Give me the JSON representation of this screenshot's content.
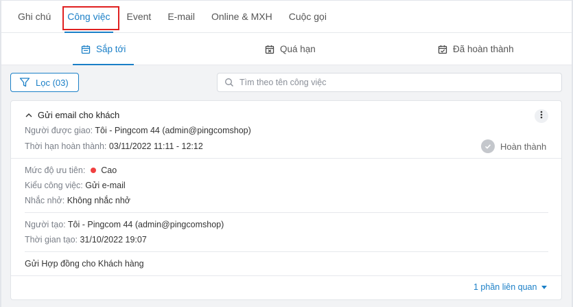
{
  "tabs": [
    "Ghi chú",
    "Công việc",
    "Event",
    "E-mail",
    "Online & MXH",
    "Cuộc gọi"
  ],
  "active_tab_index": 1,
  "subtabs": {
    "upcoming": "Sắp tới",
    "overdue": "Quá hạn",
    "done": "Đã hoàn thành"
  },
  "filter_label": "Lọc (03)",
  "search_placeholder": "Tìm theo tên công việc",
  "task": {
    "title": "Gửi email cho khách",
    "assignee_label": "Người được giao:",
    "assignee_value": "Tôi - Pingcom 44 (admin@pingcomshop)",
    "deadline_label": "Thời hạn hoàn thành:",
    "deadline_value": "03/11/2022 11:11 - 12:12",
    "complete_label": "Hoàn thành",
    "priority_label": "Mức độ ưu tiên:",
    "priority_value": "Cao",
    "type_label": "Kiểu công việc:",
    "type_value": "Gửi e-mail",
    "reminder_label": "Nhắc nhở:",
    "reminder_value": "Không nhắc nhở",
    "creator_label": "Người tạo:",
    "creator_value": "Tôi - Pingcom 44 (admin@pingcomshop)",
    "created_label": "Thời gian tạo:",
    "created_value": "31/10/2022 19:07",
    "description": "Gửi Hợp đồng cho Khách hàng",
    "related_label": "1 phần liên quan"
  },
  "colors": {
    "accent": "#1a7fc7",
    "highlight": "#e02020",
    "priority_high": "#f04040"
  }
}
